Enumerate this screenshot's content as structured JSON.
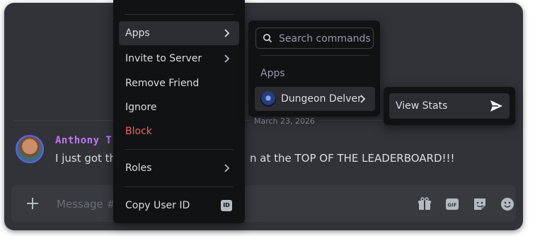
{
  "chat": {
    "date_divider": "March 23, 2026",
    "message": {
      "author": "Anthony T",
      "text_left": "I just got the",
      "text_right": "n at the TOP OF THE LEADERBOARD!!!"
    },
    "composer": {
      "placeholder": "Message #d",
      "icons": [
        "plus-icon",
        "gift-icon",
        "gif-icon",
        "sticker-icon",
        "emoji-icon"
      ]
    }
  },
  "context_menu": {
    "items": [
      {
        "label": "Apps",
        "has_submenu": true
      },
      {
        "label": "Invite to Server",
        "has_submenu": true
      },
      {
        "label": "Remove Friend"
      },
      {
        "label": "Ignore"
      },
      {
        "label": "Block",
        "danger": true
      },
      {
        "label": "Roles",
        "has_submenu": true
      },
      {
        "label": "Copy User ID",
        "badge": "ID"
      }
    ]
  },
  "apps_menu": {
    "search_placeholder": "Search commands",
    "heading": "Apps",
    "app": {
      "label": "Dungeon Delver"
    }
  },
  "commands_menu": {
    "item": {
      "label": "View Stats"
    }
  },
  "colors": {
    "background": "#313338",
    "menu": "#111214",
    "highlight": "#2b2d31",
    "danger": "#f25f61",
    "author": "#c277f4"
  }
}
